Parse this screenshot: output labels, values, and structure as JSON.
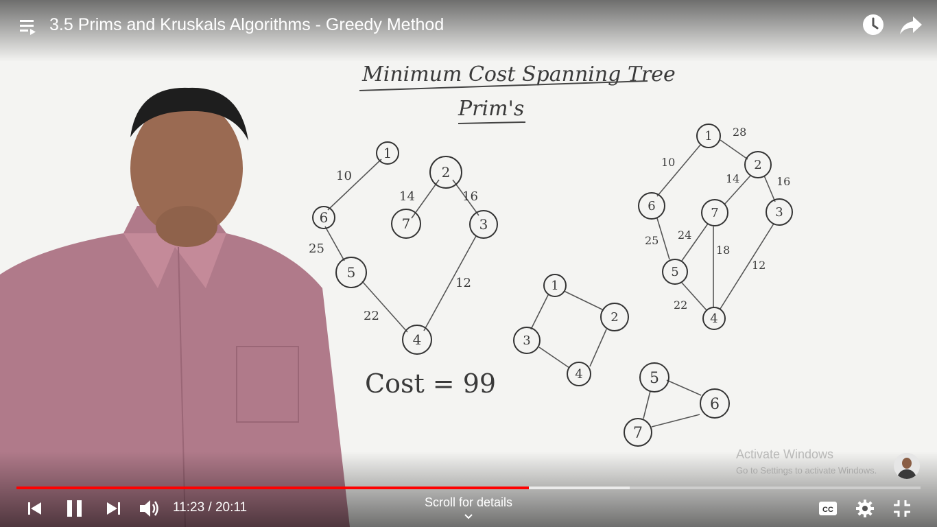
{
  "video": {
    "title": "3.5 Prims and Kruskals Algorithms - Greedy Method",
    "current_time": "11:23",
    "duration": "20:11",
    "time_display": "11:23 / 20:11",
    "played_fraction": 0.567,
    "buffered_fraction": 0.678,
    "scroll_hint": "Scroll for details"
  },
  "controls": {
    "accent_color": "#ff0000",
    "icons": [
      "playlist-icon",
      "clock-icon",
      "share-arrow-icon",
      "skip-previous-icon",
      "pause-icon",
      "skip-next-icon",
      "volume-icon",
      "chevron-down-icon",
      "captions-icon",
      "gear-icon",
      "exit-fullscreen-icon"
    ]
  },
  "whiteboard": {
    "heading": "Minimum Cost Spanning Tree",
    "subheading": "Prim's",
    "cost_text": "Cost = 99",
    "left_tree": {
      "nodes": [
        "1",
        "2",
        "3",
        "4",
        "5",
        "6",
        "7"
      ],
      "edge_weights": [
        "10",
        "14",
        "16",
        "25",
        "12",
        "22"
      ]
    },
    "right_graph": {
      "nodes": [
        "1",
        "2",
        "3",
        "4",
        "5",
        "6",
        "7"
      ],
      "edge_weights": [
        "28",
        "10",
        "14",
        "16",
        "25",
        "24",
        "18",
        "12",
        "22"
      ]
    },
    "small_graph_a": {
      "nodes": [
        "1",
        "2",
        "3",
        "4"
      ]
    },
    "small_graph_b": {
      "nodes": [
        "5",
        "6",
        "7"
      ]
    }
  },
  "watermark": {
    "line1": "Activate Windows",
    "line2": "Go to Settings to activate Windows."
  }
}
